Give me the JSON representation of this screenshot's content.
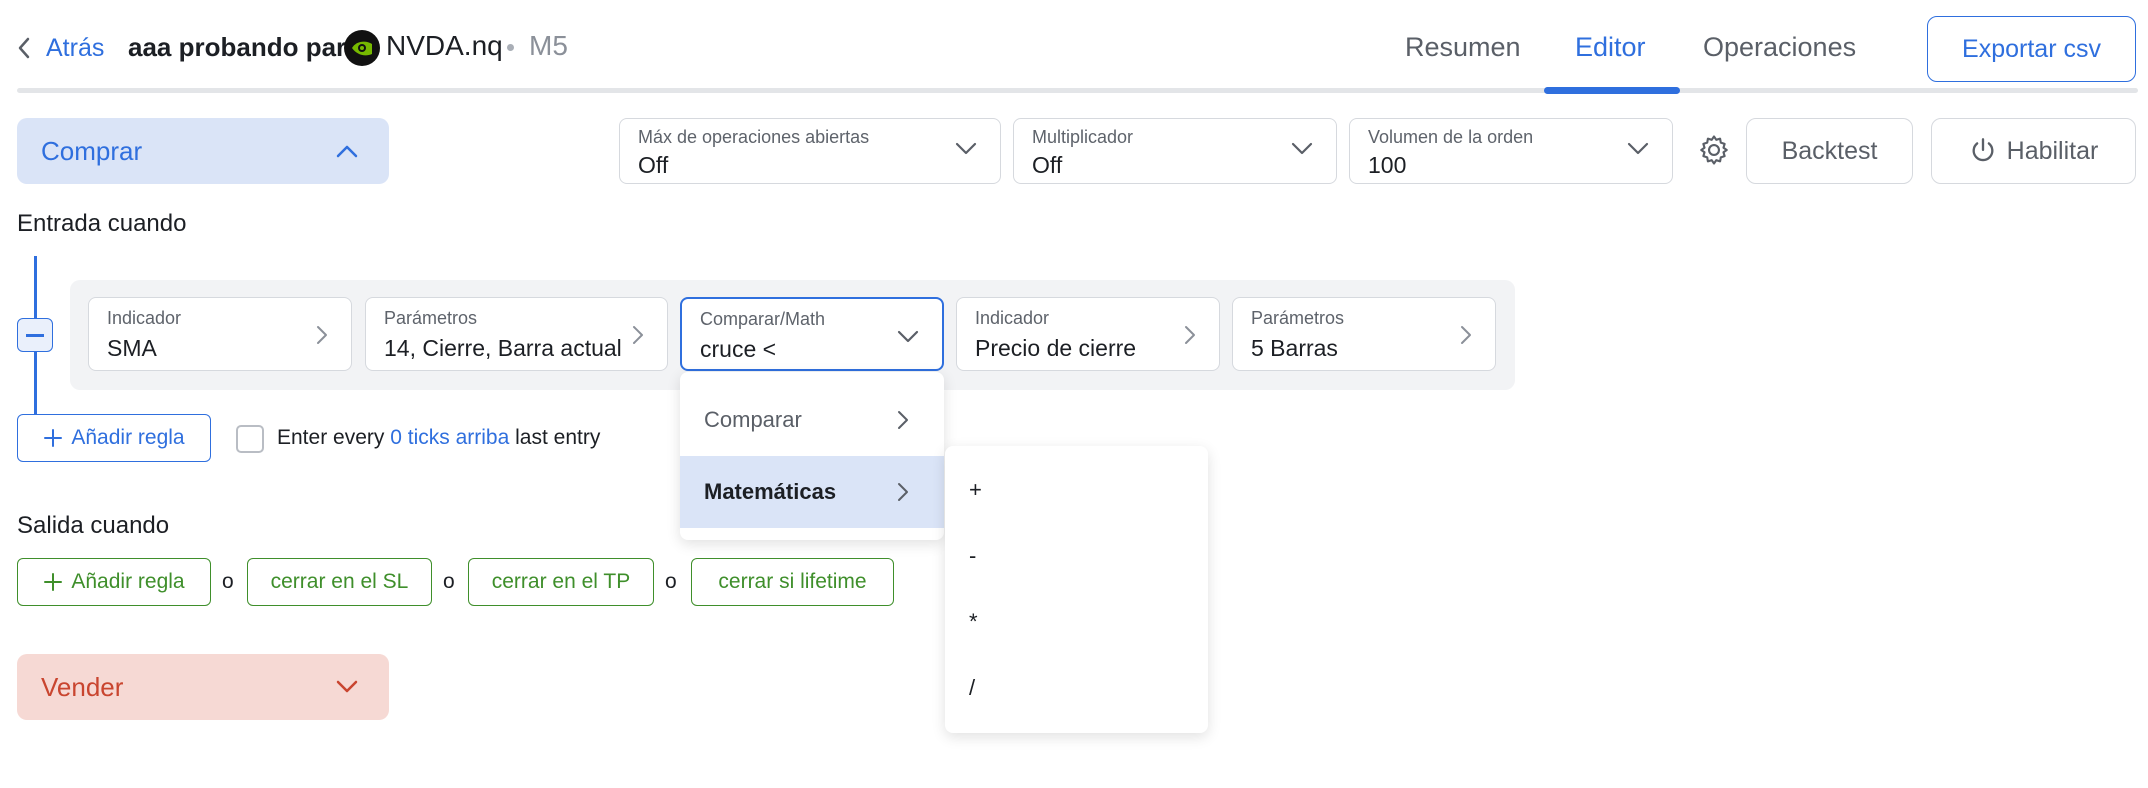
{
  "header": {
    "back_label": "Atrás",
    "title": "aaa probando para",
    "symbol": "NVDA.nq",
    "timeframe": "M5",
    "tabs": [
      {
        "label": "Resumen"
      },
      {
        "label": "Editor"
      },
      {
        "label": "Operaciones"
      }
    ],
    "active_tab": "Editor",
    "export_label": "Exportar csv"
  },
  "buy_section": {
    "label": "Comprar",
    "expanded": true
  },
  "toolbar": {
    "max_open": {
      "label": "Máx de operaciones abiertas",
      "value": "Off"
    },
    "multiplier": {
      "label": "Multiplicador",
      "value": "Off"
    },
    "order_volume": {
      "label": "Volumen de la orden",
      "value": "100"
    },
    "backtest_label": "Backtest",
    "enable_label": "Habilitar"
  },
  "entry": {
    "title": "Entrada cuando",
    "rule": {
      "indicator1": {
        "label": "Indicador",
        "value": "SMA"
      },
      "params1": {
        "label": "Parámetros",
        "value": "14, Cierre, Barra actual"
      },
      "compare": {
        "label": "Comparar/Math",
        "value": "cruce <"
      },
      "indicator2": {
        "label": "Indicador",
        "value": "Precio de cierre"
      },
      "params2": {
        "label": "Parámetros",
        "value": "5 Barras"
      }
    },
    "add_rule_label": "Añadir regla",
    "enter_every": {
      "prefix": "Enter every",
      "link": "0 ticks arriba",
      "suffix": "last entry",
      "checked": false
    }
  },
  "compare_menu": {
    "items": [
      {
        "label": "Comparar"
      },
      {
        "label": "Matemáticas"
      }
    ],
    "highlighted": "Matemáticas",
    "submenu": [
      "+",
      "-",
      "*",
      "/"
    ]
  },
  "exit": {
    "title": "Salida cuando",
    "add_rule_label": "Añadir regla",
    "separator": "o",
    "options": [
      "cerrar en el SL",
      "cerrar en el TP",
      "cerrar si lifetime"
    ]
  },
  "sell_section": {
    "label": "Vender",
    "expanded": false
  },
  "colors": {
    "accent": "#2f6fde",
    "buy_bg": "#dae4f7",
    "sell_bg": "#f6d9d4",
    "sell_text": "#c9452f",
    "exit_green": "#3f8f2b",
    "logo_green": "#76b900"
  }
}
